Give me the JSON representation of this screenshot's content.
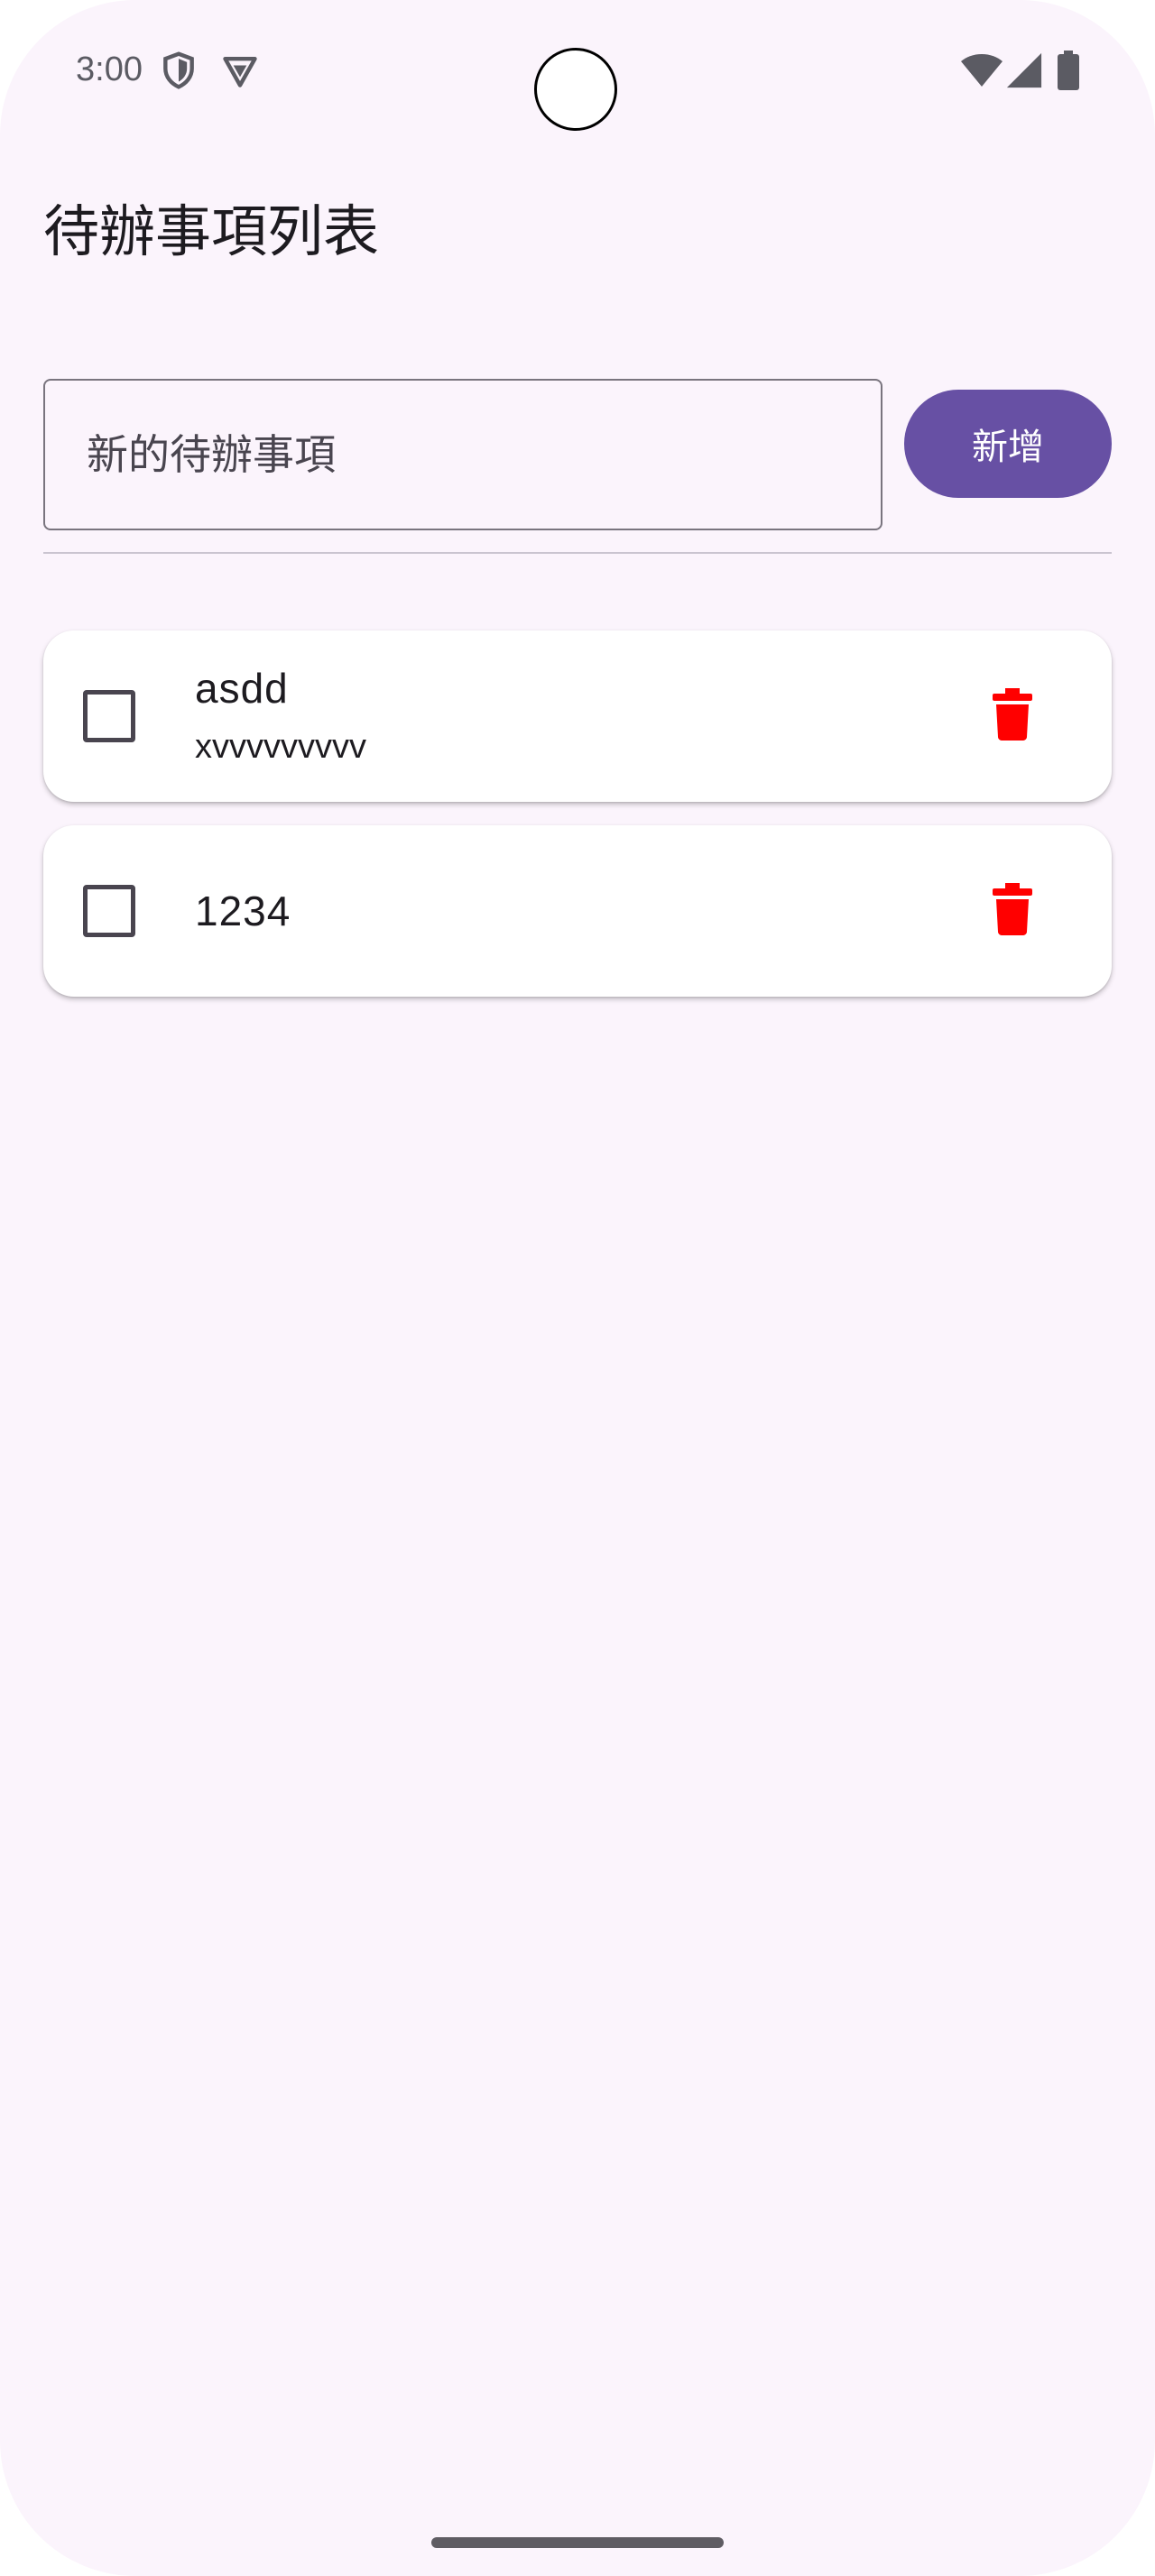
{
  "status_bar": {
    "time": "3:00",
    "left_icons": [
      "shield-icon",
      "vpn-key-icon"
    ],
    "right_icons": [
      "wifi-icon",
      "signal-icon",
      "battery-icon"
    ]
  },
  "page": {
    "title": "待辦事項列表"
  },
  "new_todo": {
    "placeholder": "新的待辦事項",
    "value": "",
    "add_label": "新增"
  },
  "todos": [
    {
      "title": "asdd",
      "description": "xvvvvvvvvv",
      "checked": false,
      "delete_icon": "trash-icon"
    },
    {
      "title": "1234",
      "description": "",
      "checked": false,
      "delete_icon": "trash-icon"
    }
  ],
  "colors": {
    "background": "#fbf4fc",
    "primary": "#6750a4",
    "delete": "#ff0000",
    "card": "#ffffff"
  }
}
